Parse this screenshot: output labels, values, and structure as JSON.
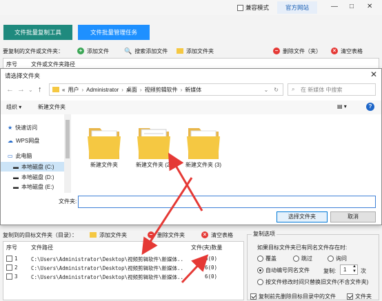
{
  "topbar": {
    "compat_label": "兼容模式",
    "site_label": "官方网站",
    "minimize": "—",
    "restore": "□",
    "close": "✕"
  },
  "tabs": [
    {
      "label": "文件批量复制工具"
    },
    {
      "label": "文件批量管理任务"
    }
  ],
  "toolbar1": {
    "section_label": "要复制的文件或文件夹：",
    "add_file": "添加文件",
    "search_add_file": "搜索添加文件",
    "add_folder": "添加文件夹",
    "delete_file": "删除文件（夹）",
    "clear_table": "清空表格"
  },
  "table1": {
    "col_index": "序号",
    "col_path": "文件或文件夹路径"
  },
  "dialog": {
    "title": "请选择文件夹",
    "breadcrumb": [
      "«",
      "用户",
      "Administrator",
      "桌面",
      "视频剪辑软件",
      "新媒体"
    ],
    "search_placeholder": "在 新媒体 中搜索",
    "organize": "组织 ▾",
    "new_folder": "新建文件夹",
    "nav_items": [
      {
        "label": "快速访问",
        "icon": "star-icon"
      },
      {
        "label": "WPS网盘",
        "icon": "cloud-icon"
      },
      {
        "label": "此电脑",
        "icon": "computer-icon"
      },
      {
        "label": "本地磁盘 (C:)",
        "icon": "drive-icon"
      },
      {
        "label": "本地磁盘 (D:)",
        "icon": "drive-icon"
      },
      {
        "label": "本地磁盘 (E:)",
        "icon": "drive-icon"
      }
    ],
    "folders": [
      {
        "label": "新建文件夹"
      },
      {
        "label": "新建文件夹 (2)"
      },
      {
        "label": "新建文件夹 (3)"
      }
    ],
    "filename_label": "文件夹:",
    "filename_value": "",
    "select_button": "选择文件夹",
    "cancel_button": "取消"
  },
  "toolbar2": {
    "section_label": "复制到的目标文件夹（目录）：",
    "add_folder": "添加文件夹",
    "delete_folder": "删除文件夹",
    "clear_table": "清空表格"
  },
  "table2": {
    "col_index": "序号",
    "col_path": "文件路径",
    "col_count": "文件(夹)数量",
    "rows": [
      {
        "index": "1",
        "path": "C:\\Users\\Administrator\\Desktop\\视频剪辑软件\\新媒体...",
        "count": "6(0)"
      },
      {
        "index": "2",
        "path": "C:\\Users\\Administrator\\Desktop\\视频剪辑软件\\新媒体...",
        "count": "6(0)"
      },
      {
        "index": "3",
        "path": "C:\\Users\\Administrator\\Desktop\\视频剪辑软件\\新媒体...",
        "count": "6(0)"
      }
    ]
  },
  "options": {
    "legend": "复制选项",
    "question": "如果目标文件夹已有同名文件存在时:",
    "overwrite": "覆盖",
    "skip": "跳过",
    "ask": "询问",
    "auto_rename": "自动编号同名文件",
    "copies_label": "复制:",
    "copies_value": "1",
    "copies_unit": "次",
    "by_time": "按文件修改时间只替换旧文件(不含文件夹)",
    "delete_before": "复制前先删除目标目录中的文件",
    "files_label": "文件夹"
  },
  "colors": {
    "accent_red": "#e53935",
    "tab_teal": "#1f8a7e",
    "tab_blue": "#1e90ff",
    "folder_yellow": "#f5c842"
  }
}
